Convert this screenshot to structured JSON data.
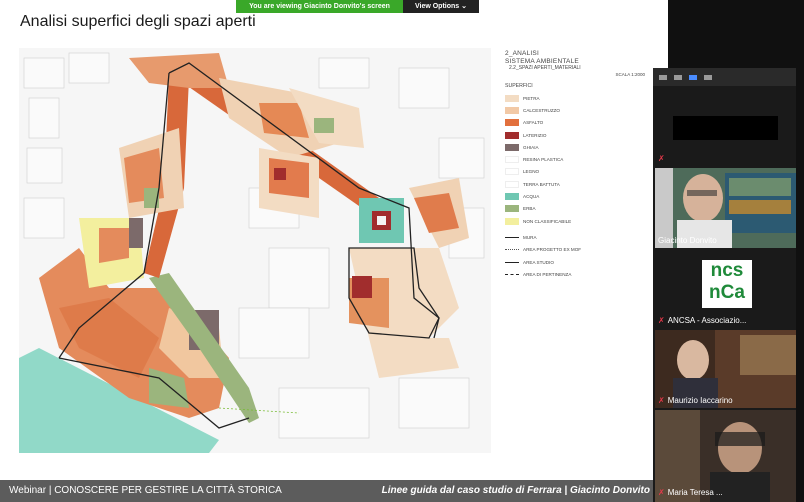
{
  "screen_share": {
    "banner_message": "You are viewing Giacinto Donvito's screen",
    "view_options_label": "View Options",
    "view_options_chevron": "chevron-down-icon"
  },
  "slide": {
    "title": "Analisi superfici degli spazi aperti",
    "legend": {
      "header_line1": "2_ANALISI",
      "header_line2": "SISTEMA AMBIENTALE",
      "subheader": "2.2_SPAZI APERTI_MATERIALI",
      "scale": "SCALA 1:2000",
      "section_title": "SUPERFICI",
      "items": [
        {
          "label": "PIETRA",
          "color": "#f3dcc3"
        },
        {
          "label": "CALCESTRUZZO",
          "color": "#f2c9a6"
        },
        {
          "label": "ASFALTO",
          "color": "#e2703d"
        },
        {
          "label": "LATERIZIO",
          "color": "#a12d2d"
        },
        {
          "label": "GHIAIA",
          "color": "#7c6a6a"
        },
        {
          "label": "RESINA PLASTICA",
          "color": "#ffffff"
        },
        {
          "label": "LEGNO",
          "color": "#ffffff"
        },
        {
          "label": "TERRA BATTUTA",
          "color": "#ffffff"
        },
        {
          "label": "ACQUA",
          "color": "#6fc7b2"
        },
        {
          "label": "ERBA",
          "color": "#9bb57d"
        },
        {
          "label": "NON CLASSIFICABILE",
          "color": "#f3ef9e"
        }
      ],
      "lines": [
        {
          "label": "MURA",
          "style": "mura"
        },
        {
          "label": "AREA PROGETTO EX MOF",
          "style": "dotted"
        },
        {
          "label": "AREA STUDIO",
          "style": "solid"
        },
        {
          "label": "AREA DI PERTINENZA",
          "style": "dashdot"
        }
      ]
    }
  },
  "footer": {
    "left": "Webinar | CONOSCERE PER GESTIRE LA CITTÀ STORICA",
    "right": "Linee guida dal caso studio di Ferrara | Giacinto Donvito"
  },
  "gallery": {
    "participants": [
      {
        "name": "",
        "muted": true,
        "video": false
      },
      {
        "name": "Giacinto Donvito",
        "muted": false,
        "video": true
      },
      {
        "name": "ANCSA - Associazio...",
        "muted": true,
        "video": false,
        "logo_line1": "ncs",
        "logo_line2": "nCa",
        "logo_color": "#1f8a3a"
      },
      {
        "name": "Maurizio Iaccarino",
        "muted": true,
        "video": true
      },
      {
        "name": "Maria Teresa ...",
        "muted": true,
        "video": true
      }
    ]
  }
}
